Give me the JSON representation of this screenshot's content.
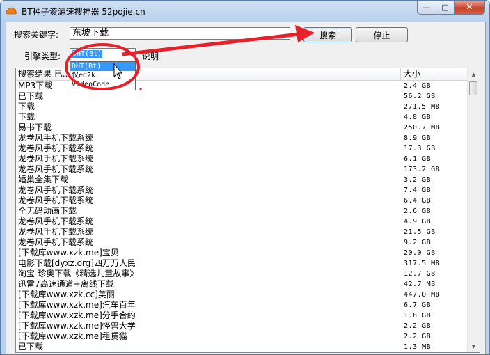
{
  "window": {
    "title": "BT种子资源速搜神器 52pojie.cn",
    "controls": {
      "minimize": "—",
      "maximize": "□",
      "close": "✕"
    }
  },
  "search": {
    "keyword_label": "搜索关键字:",
    "keyword_value": "东坡下载",
    "search_button": "搜索",
    "stop_button": "停止"
  },
  "engine": {
    "label": "引擎类型:",
    "selected": "DHT(Bt)",
    "help_link": "说明",
    "options": [
      "DHT(Bt)",
      "仅ed2k",
      "VideoCode"
    ]
  },
  "results": {
    "columns": {
      "name": "搜索结果 已...10秒",
      "size": "大小"
    },
    "rows": [
      {
        "name": "MP3下载",
        "size": "2.4 GB"
      },
      {
        "name": "已下载",
        "size": "56.2 GB"
      },
      {
        "name": "下载",
        "size": "271.5 MB"
      },
      {
        "name": "下载",
        "size": "4.8 GB"
      },
      {
        "name": "易书下载",
        "size": "250.7 MB"
      },
      {
        "name": "龙卷风手机下载系统",
        "size": "8.9 GB"
      },
      {
        "name": "龙卷风手机下载系统",
        "size": "17.3 GB"
      },
      {
        "name": "龙卷风手机下载系统",
        "size": "6.1 GB"
      },
      {
        "name": "龙卷风手机下载系统",
        "size": "173.2 GB"
      },
      {
        "name": "婚巢全集下载",
        "size": "3.2 GB"
      },
      {
        "name": "龙卷风手机下载系统",
        "size": "7.4 GB"
      },
      {
        "name": "龙卷风手机下载系统",
        "size": "6.4 GB"
      },
      {
        "name": "全无码动画下载",
        "size": "2.6 GB"
      },
      {
        "name": "龙卷风手机下载系统",
        "size": "4.9 GB"
      },
      {
        "name": "龙卷风手机下载系统",
        "size": "21.5 GB"
      },
      {
        "name": "龙卷风手机下载系统",
        "size": "9.2 GB"
      },
      {
        "name": "[下载库www.xzk.me]宝贝",
        "size": "20.0 GB"
      },
      {
        "name": "电影下载[dyxz.org]四万万人民",
        "size": "317.5 MB"
      },
      {
        "name": "淘宝-珍奥下载《精选儿童故事》",
        "size": "12.7 GB"
      },
      {
        "name": "迅雷7高速通道+离线下载",
        "size": "42.7 MB"
      },
      {
        "name": "[下载库www.xzk.cc]美丽",
        "size": "447.0 MB"
      },
      {
        "name": "[下载库www.xzk.me]汽车百年",
        "size": "6.7 GB"
      },
      {
        "name": "[下载库www.xzk.me]分手合约",
        "size": "1.8 GB"
      },
      {
        "name": "[下载库www.xzk.me]怪兽大学",
        "size": "2.2 GB"
      },
      {
        "name": "[下载库www.xzk.me]租赁猫",
        "size": "2.2 GB"
      },
      {
        "name": "已下载",
        "size": "1.3 MB"
      }
    ]
  },
  "annotation_colors": {
    "highlight": "#e8202a"
  }
}
